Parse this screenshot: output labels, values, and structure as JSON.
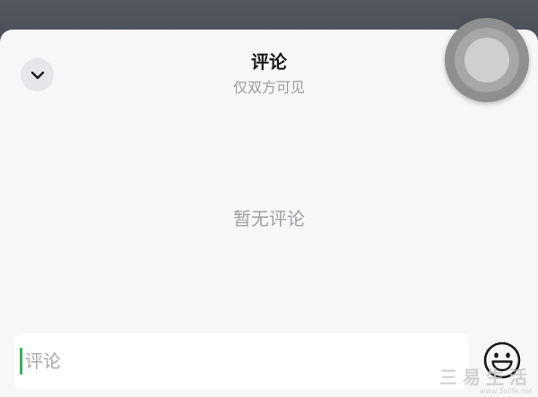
{
  "comment_panel": {
    "title": "评论",
    "subtitle": "仅双方可见",
    "collapse_icon": "chevron-down-icon",
    "empty_text": "暂无评论"
  },
  "comment_input": {
    "placeholder": "评论",
    "value": "",
    "caret_color": "#2fb25a"
  },
  "emoji_button": {
    "icon": "smiley-face-icon"
  },
  "floating_ball": {
    "icon": "assistive-touch-icon"
  },
  "watermark": {
    "main": "三易生活",
    "url": "www.3elife.net"
  }
}
